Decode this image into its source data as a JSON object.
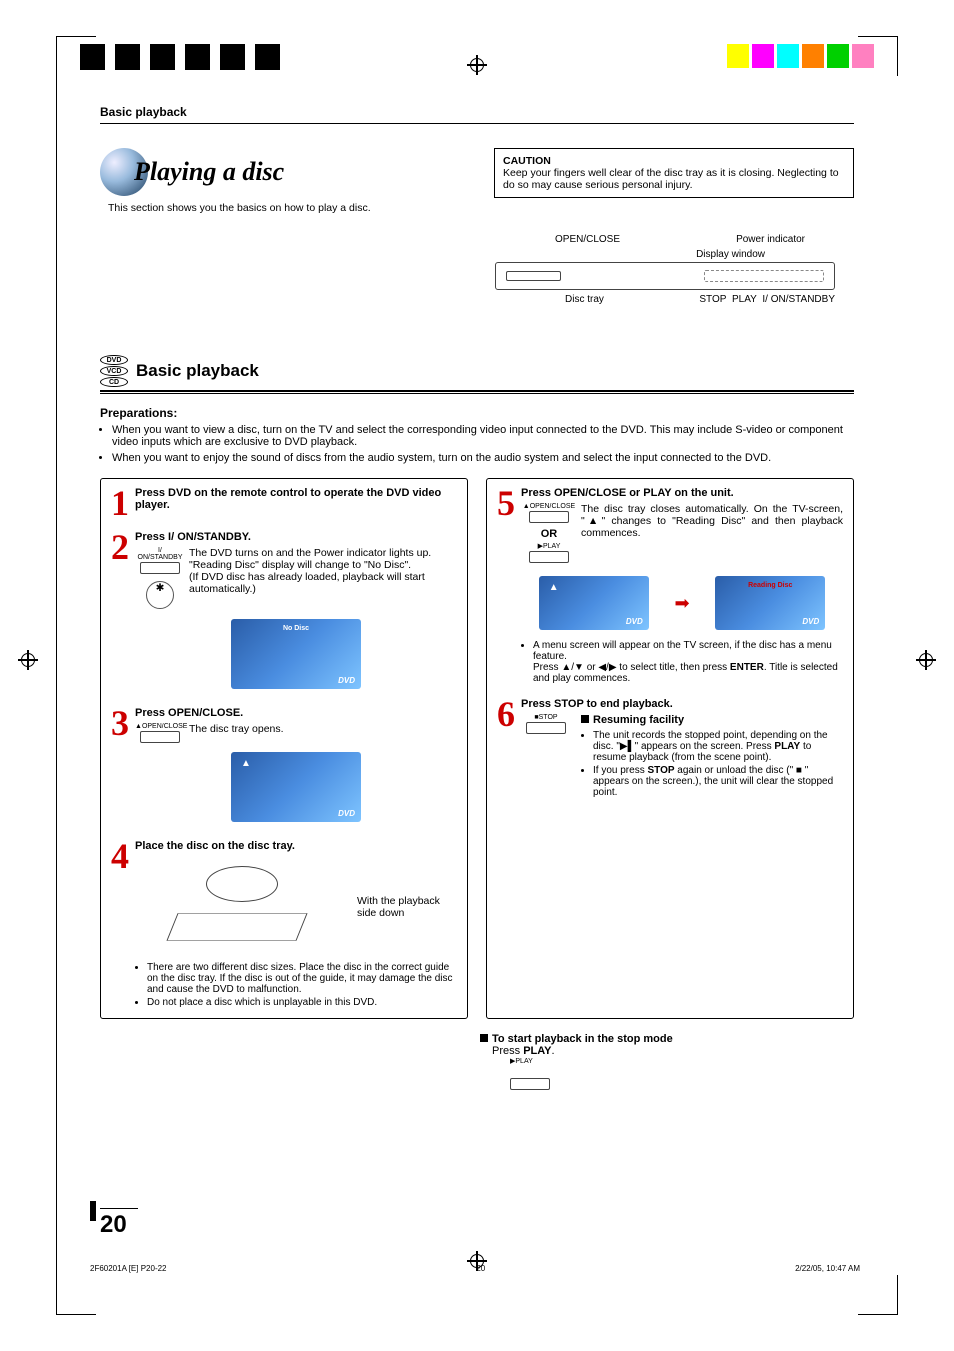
{
  "header": {
    "section": "Basic playback"
  },
  "title": {
    "main": "Playing a disc",
    "sub": "This section shows you the basics on how to play a disc."
  },
  "caution": {
    "label": "CAUTION",
    "text": "Keep your fingers well clear of the disc tray as it is closing. Neglecting to do so may cause serious personal injury."
  },
  "diagram": {
    "open_close": "OPEN/CLOSE",
    "power_ind": "Power indicator",
    "display_window": "Display window",
    "disc_tray": "Disc tray",
    "stop": "STOP",
    "play": "PLAY",
    "on_standby": "I/ ON/STANDBY"
  },
  "disc_badges": {
    "dvd": "DVD",
    "vcd": "VCD",
    "cd": "CD"
  },
  "bp_heading": "Basic playback",
  "prep": {
    "label": "Preparations:",
    "b1": "When you want to view a disc, turn on the TV and select the corresponding video input connected to the DVD. This may include S-video or component video inputs which are exclusive to DVD playback.",
    "b2": "When you want to enjoy the sound of discs from the audio system, turn on the audio system and select the input connected to the DVD."
  },
  "steps": {
    "s1": {
      "num": "1",
      "head": "Press DVD on the remote control to operate the DVD video player."
    },
    "s2": {
      "num": "2",
      "head": "Press I/ ON/STANDBY.",
      "l1": "The DVD turns on and the Power indicator lights up.",
      "l2": "\"Reading Disc\" display will change to \"No Disc\".",
      "l3": "(If DVD disc has already loaded, playback will start automatically.)",
      "screen": "No Disc",
      "logo": "DVD",
      "btn": "I/ ON/STANDBY"
    },
    "s3": {
      "num": "3",
      "head": "Press OPEN/CLOSE.",
      "l1": "The disc tray opens.",
      "btn": "OPEN/CLOSE",
      "logo": "DVD"
    },
    "s4": {
      "num": "4",
      "head": "Place the disc on the disc tray.",
      "side": "With the playback side down",
      "b1": "There are two different disc sizes. Place the disc in the correct guide on the disc tray. If the disc is out of the guide, it may damage the disc and cause the DVD to malfunction.",
      "b2": "Do not place a disc which is unplayable in this DVD."
    },
    "s5": {
      "num": "5",
      "head": "Press OPEN/CLOSE or PLAY on the unit.",
      "l1": "The disc tray closes automatically. On the TV-screen, \"▲\" changes to \"Reading Disc\" and then playback commences.",
      "or": "OR",
      "btn1": "OPEN/CLOSE",
      "btn2": "PLAY",
      "screen2": "Reading Disc",
      "logo": "DVD",
      "m1": "A menu screen will appear on the TV screen, if the disc has a menu feature.",
      "m2a": "Press ▲/▼ or ◀/▶ to select title, then press ",
      "m2b": "ENTER",
      "m2c": ". Title is selected and play commences."
    },
    "s6": {
      "num": "6",
      "head": "Press STOP to end playback.",
      "btn": "STOP",
      "resume_label": "Resuming facility",
      "r1a": "The unit records the stopped point, depending on the disc. \"▶▌\" appears on the screen. Press ",
      "r1b": "PLAY",
      "r1c": " to resume playback (from the scene point).",
      "r2a": "If you press ",
      "r2b": "STOP",
      "r2c": " again or unload the disc (\" ■ \" appears on the screen.), the unit will clear the stopped point."
    }
  },
  "bottom": {
    "hdr": "To start playback in the stop mode",
    "l1a": "Press ",
    "l1b": "PLAY",
    "l1c": ".",
    "btn": "PLAY"
  },
  "page_number": "20",
  "footer": {
    "left": "2F60201A [E] P20-22",
    "center": "20",
    "right": "2/22/05, 10:47 AM"
  },
  "colors": {
    "c1": "#ffff00",
    "c2": "#ff00ff",
    "c3": "#00ffff",
    "c4": "#ff8000",
    "c5": "#00d000",
    "c6": "#ff80c0"
  }
}
